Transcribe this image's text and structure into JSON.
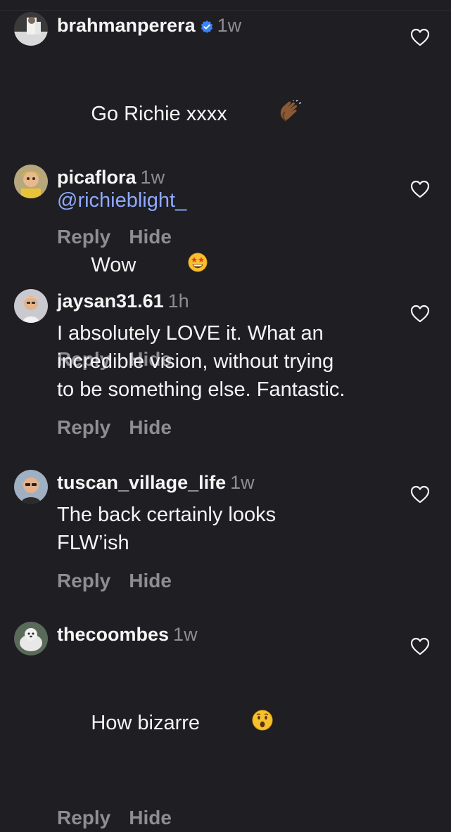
{
  "comments": [
    {
      "username": "brahmanperera",
      "verified": true,
      "time": "1w",
      "text": "Go Richie xxxx",
      "emoji": "clapping-hands",
      "mention": "@richieblight_",
      "reply_label": "Reply",
      "hide_label": "Hide"
    },
    {
      "username": "picaflora",
      "verified": false,
      "time": "1w",
      "text": "Wow",
      "emoji": "star-struck-face",
      "reply_label": "Reply",
      "hide_label": "Hide"
    },
    {
      "username": "jaysan31.61",
      "verified": false,
      "time": "1h",
      "text": "I absolutely LOVE it. What an\nincredible vision, without trying\nto be something else. Fantastic.",
      "reply_label": "Reply",
      "hide_label": "Hide"
    },
    {
      "username": "tuscan_village_life",
      "verified": false,
      "time": "1w",
      "text": "The back certainly looks\nFLW’ish",
      "reply_label": "Reply",
      "hide_label": "Hide"
    },
    {
      "username": "thecoombes",
      "verified": false,
      "time": "1w",
      "text": "How bizarre",
      "emoji": "hushed-face",
      "reply_label": "Reply",
      "hide_label": "Hide"
    }
  ],
  "colors": {
    "background": "#1e1e23",
    "text": "#f5f5f5",
    "muted": "#8d8d93",
    "mention": "#8fa9ff",
    "verified": "#3b82f6"
  }
}
